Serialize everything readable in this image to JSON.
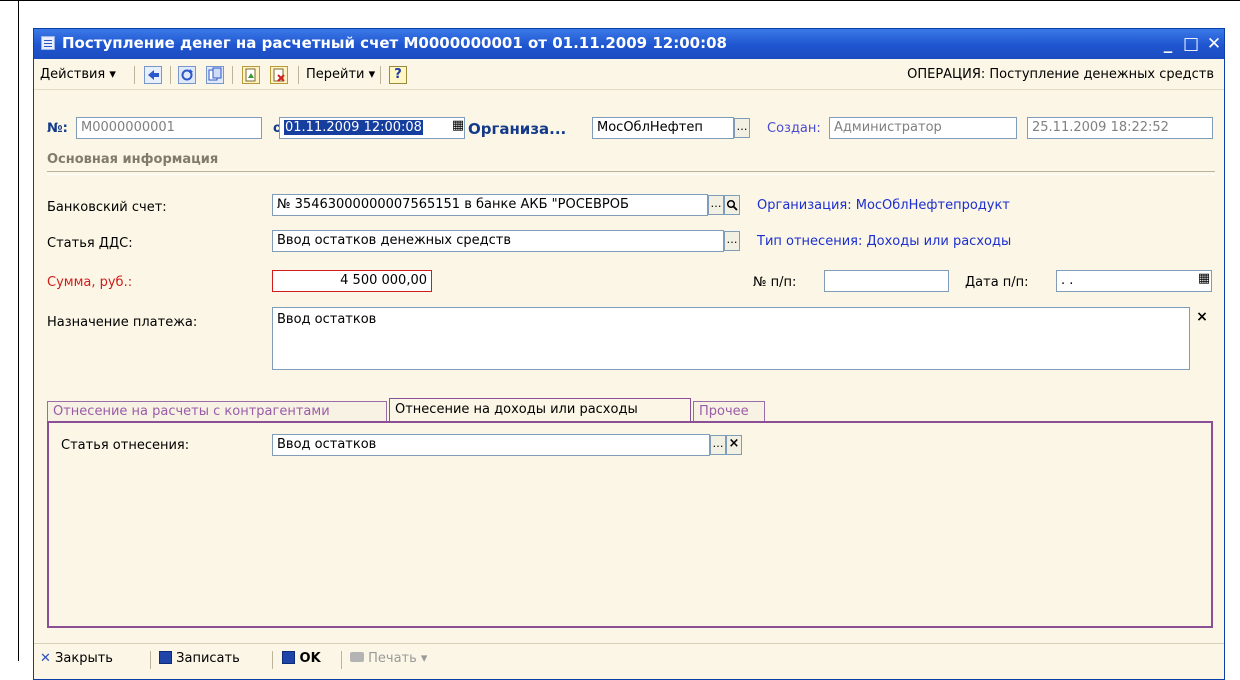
{
  "window": {
    "title": "Поступление денег на расчетный счет М0000000001 от 01.11.2009 12:00:08",
    "minimize": "_",
    "maximize": "□",
    "close": "✕"
  },
  "toolbar": {
    "actions_label": "Действия ▾",
    "goto_label": "Перейти ▾",
    "help_label": "?",
    "operation_label": "ОПЕРАЦИЯ: Поступление денежных средств"
  },
  "header": {
    "number_label": "№:",
    "number_value": "М0000000001",
    "date_label": "от",
    "date_value": "01.11.2009 12:00:08",
    "org_label": "Организа...",
    "org_value": "МосОблНефтеп",
    "created_label": "Создан:",
    "created_value": "Администратор",
    "created_date": "25.11.2009 18:22:52"
  },
  "section": {
    "title": "Основная информация"
  },
  "form": {
    "bank_account_label": "Банковский счет:",
    "bank_account_value": "№ 35463000000007565151 в банке АКБ \"РОСЕВРОБ",
    "bank_org_link": "Организация: МосОблНефтепродукт",
    "dds_label": "Статья ДДС:",
    "dds_value": "Ввод остатков денежных средств",
    "dds_link": "Тип отнесения: Доходы или расходы",
    "sum_label": "Сумма, руб.:",
    "sum_value": "4 500 000,00",
    "pp_number_label": "№ п/п:",
    "pp_number_value": "",
    "pp_date_label": "Дата п/п:",
    "pp_date_value": " .  .",
    "purpose_label": "Назначение платежа:",
    "purpose_value": "Ввод остатков"
  },
  "tabs": [
    {
      "label": "Отнесение на расчеты с контрагентами",
      "active": false
    },
    {
      "label": "Отнесение на доходы или расходы",
      "active": true
    },
    {
      "label": "Прочее",
      "active": false
    }
  ],
  "tab_content": {
    "article_label": "Статья отнесения:",
    "article_value": "Ввод остатков"
  },
  "bottombar": {
    "close_label": "Закрыть",
    "save_label": "Записать",
    "ok_label": "OK",
    "print_label": "Печать ▾"
  },
  "colors": {
    "title_blue": "#1f55cf",
    "form_bg": "#fbf6e5",
    "link_blue": "#1c2fd0",
    "required_red": "#d21c1c",
    "tab_purple": "#8a4f95"
  }
}
